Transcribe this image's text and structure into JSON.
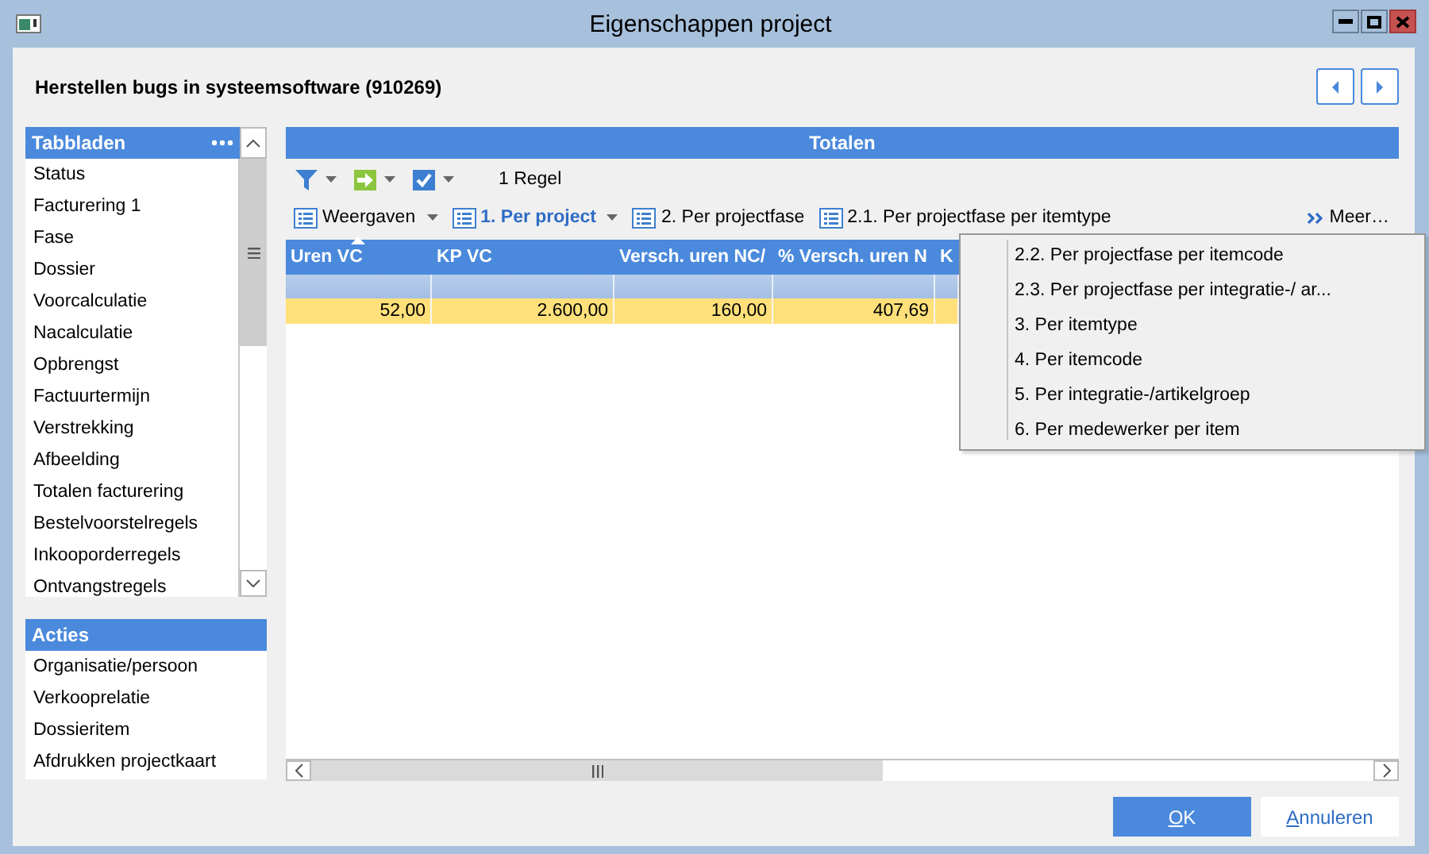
{
  "window": {
    "title": "Eigenschappen project"
  },
  "header": {
    "title": "Herstellen bugs in systeemsoftware (910269)"
  },
  "tabbladen": {
    "title": "Tabbladen",
    "items": [
      "Status",
      "Facturering 1",
      "Fase",
      "Dossier",
      "Voorcalculatie",
      "Nacalculatie",
      "Opbrengst",
      "Factuurtermijn",
      "Verstrekking",
      "Afbeelding",
      "Totalen facturering",
      "Bestelvoorstelregels",
      "Inkooporderregels",
      "Ontvangstregels"
    ]
  },
  "acties": {
    "title": "Acties",
    "items": [
      "Organisatie/persoon",
      "Verkooprelatie",
      "Dossieritem",
      "Afdrukken projectkaart"
    ]
  },
  "totalen": {
    "title": "Totalen",
    "record_count": "1 Regel",
    "views": [
      {
        "label": "Weergaven",
        "selected": false,
        "dropdown": true
      },
      {
        "label": "1. Per project",
        "selected": true,
        "dropdown": true
      },
      {
        "label": "2. Per projectfase",
        "selected": false,
        "dropdown": false
      },
      {
        "label": "2.1. Per projectfase per itemtype",
        "selected": false,
        "dropdown": false
      }
    ],
    "more": "Meer…",
    "grid": {
      "columns": [
        {
          "label": "Uren VC",
          "sorted": true
        },
        {
          "label": "KP VC",
          "sorted": false
        },
        {
          "label": "Versch. uren NC/",
          "sorted": false
        },
        {
          "label": "% Versch. uren N",
          "sorted": false
        },
        {
          "label": "K",
          "sorted": false
        }
      ],
      "rows": [
        {
          "selected": true,
          "cells": [
            "52,00",
            "2.600,00",
            "160,00",
            "407,69"
          ]
        }
      ]
    }
  },
  "menu": {
    "items": [
      "2.2. Per projectfase per itemcode",
      "2.3. Per projectfase per integratie-/ ar...",
      "3. Per itemtype",
      "4. Per itemcode",
      "5. Per integratie-/artikelgroep",
      "6. Per medewerker per item"
    ]
  },
  "buttons": [
    {
      "label": "OK",
      "kind": "primary"
    },
    {
      "label": "Annuleren",
      "kind": "secondary"
    }
  ]
}
